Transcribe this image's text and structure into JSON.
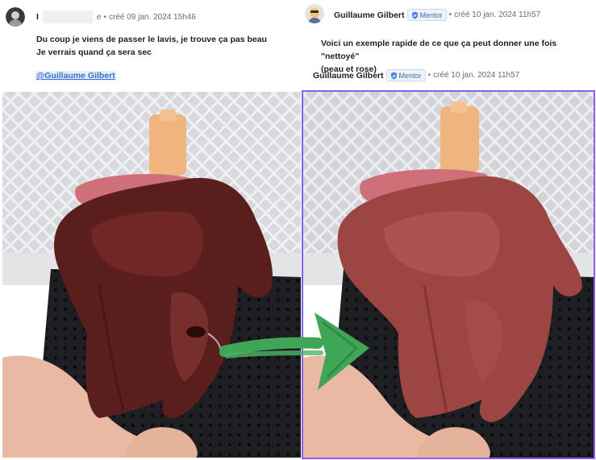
{
  "left_post": {
    "author_initial": "I",
    "author_suffix": "e",
    "timestamp": "créé 09 jan. 2024 15h46",
    "message_lines": [
      "Du coup je viens de passer le lavis, je trouve ça pas beau",
      "Je verrais quand ça sera sec"
    ],
    "mention": "@Guillaume Gilbert"
  },
  "right_post": {
    "author": "Guillaume Gilbert",
    "badge": "Mentor",
    "timestamp": "créé 10 jan. 2024 11h57",
    "message_lines": [
      "Voici un exemple rapide de ce que ça peut donner une fois \"nettoyé\"",
      "(peau et rose)"
    ],
    "footer_author": "Guillaume Gilbert",
    "footer_badge": "Mentor",
    "footer_timestamp": "créé 10 jan. 2024 11h57"
  },
  "colors": {
    "accent_purple": "#8b5cf6",
    "arrow_green": "#3fa657",
    "mention_blue": "#2f6ed8",
    "mentor_badge": "#4a6fa5"
  },
  "icons": {
    "verified": "shield-check-icon",
    "arrow": "green-arrow-icon"
  }
}
